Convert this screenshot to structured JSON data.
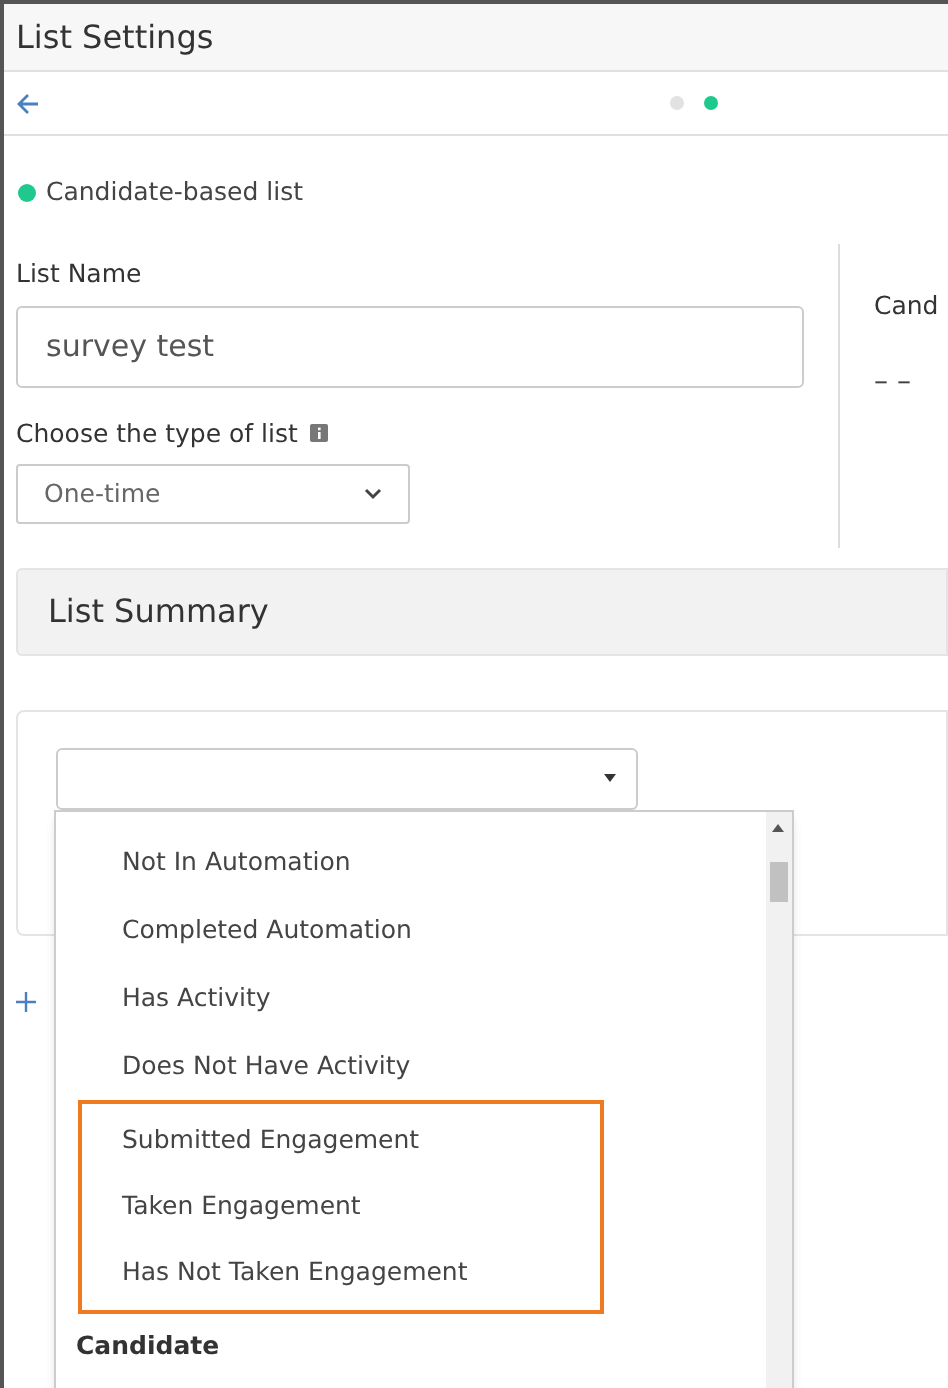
{
  "window": {
    "title": "List Settings"
  },
  "steps": [
    {
      "selected": false
    },
    {
      "selected": true
    }
  ],
  "list_type_badge": {
    "label": "Candidate-based list",
    "color": "#1fc98e"
  },
  "form": {
    "name_label": "List Name",
    "name_value": "survey test",
    "type_label": "Choose the type of list",
    "type_value": "One-time"
  },
  "side_stat": {
    "label": "Cand",
    "value": "– –"
  },
  "summary": {
    "title": "List Summary"
  },
  "filter_dropdown": {
    "expanded": true,
    "options": [
      {
        "kind": "option",
        "label": "Not In Automation",
        "highlighted": false
      },
      {
        "kind": "option",
        "label": "Completed Automation",
        "highlighted": false
      },
      {
        "kind": "option",
        "label": "Has Activity",
        "highlighted": false
      },
      {
        "kind": "option",
        "label": "Does Not Have Activity",
        "highlighted": false
      },
      {
        "kind": "option",
        "label": "Submitted Engagement",
        "highlighted": true
      },
      {
        "kind": "option",
        "label": "Taken Engagement",
        "highlighted": true
      },
      {
        "kind": "option",
        "label": "Has Not Taken Engagement",
        "highlighted": true
      },
      {
        "kind": "group",
        "label": "Candidate",
        "highlighted": false
      }
    ]
  }
}
